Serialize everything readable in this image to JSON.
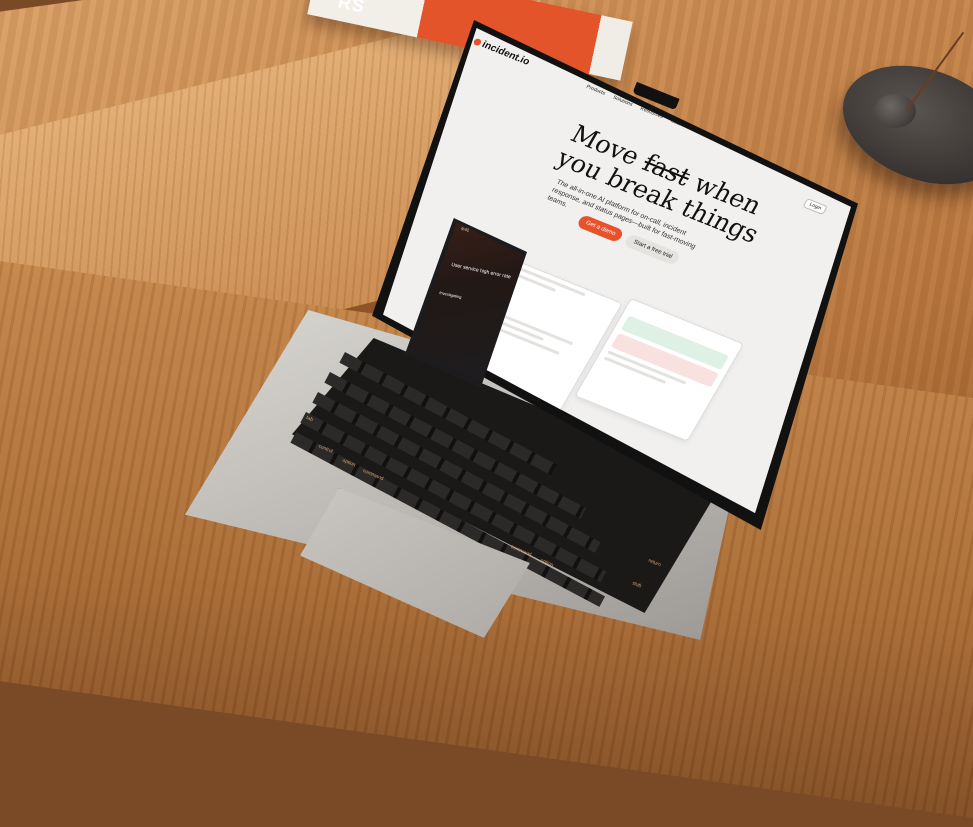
{
  "background": {
    "book_spine_text": "RS",
    "colors": {
      "wood": "#c98a50",
      "accent": "#e8512a",
      "laptop": "#c8c5c0"
    }
  },
  "site": {
    "logo": "incident.io",
    "nav": [
      "Products",
      "Solutions",
      "Resources",
      "Customers",
      "Pricing",
      "Company"
    ],
    "login": "Login",
    "headline_line1_a": "Move",
    "headline_line1_struck": "fast",
    "headline_line1_b": "when",
    "headline_line2": "you break things",
    "subtitle": "The all-in-one AI platform for on-call, incident response, and status pages—built for fast-moving teams.",
    "cta_primary": "Get a demo",
    "cta_secondary": "Start a free trial"
  },
  "phone": {
    "time": "9:41",
    "title": "User service high error rate",
    "status": "Investigating"
  },
  "keyboard": {
    "labels": [
      "esc",
      "tab",
      "caps lock",
      "shift",
      "control",
      "option",
      "command",
      "command",
      "option",
      "return",
      "shift",
      "delete"
    ]
  }
}
